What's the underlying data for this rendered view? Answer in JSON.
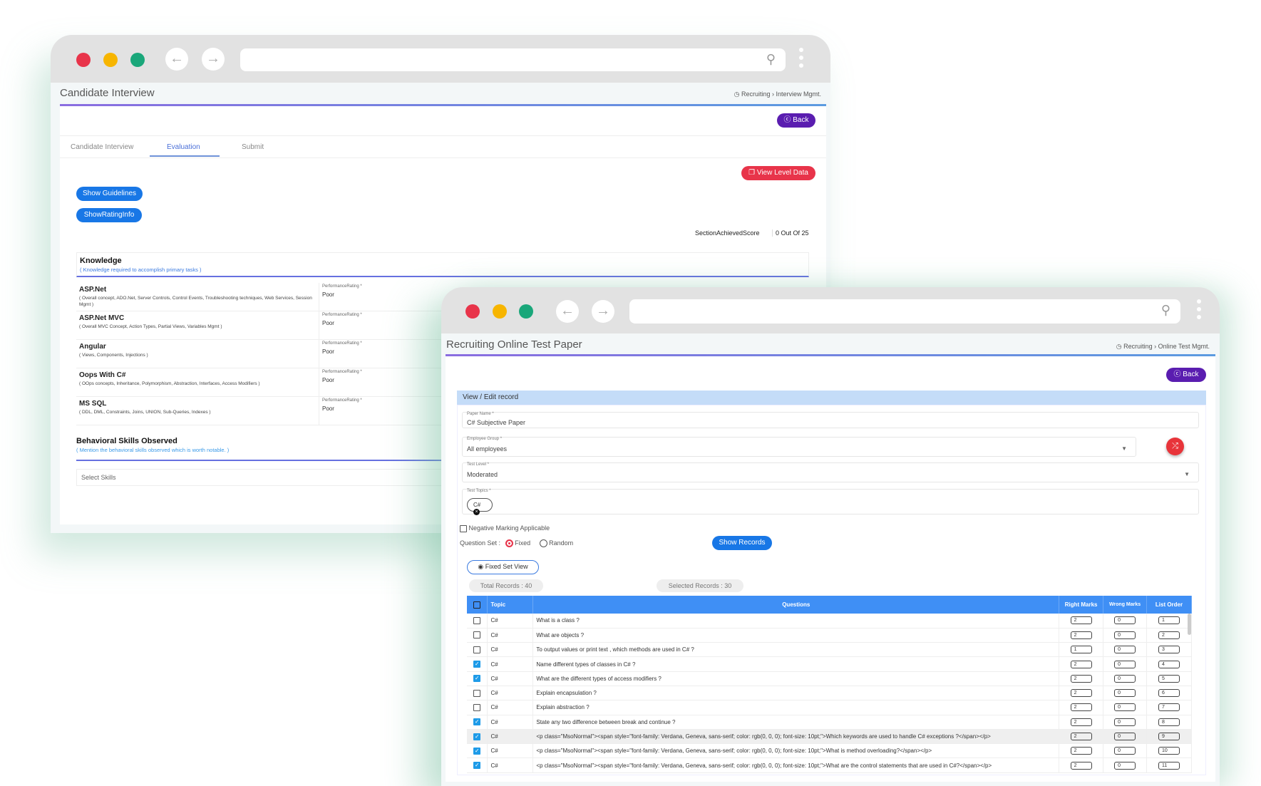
{
  "colors": {
    "red": "#e8344a",
    "yellow": "#f7b500",
    "green": "#1aa77a",
    "back": "#5a1db0",
    "blue": "#1877e6",
    "header": "#3f8ff5"
  },
  "interview": {
    "title": "Candidate Interview",
    "breadcrumb": [
      "Recruiting",
      "Interview Mgmt."
    ],
    "back_label": "Back",
    "tabs": [
      {
        "label": "Candidate Interview"
      },
      {
        "label": "Evaluation"
      },
      {
        "label": "Submit"
      }
    ],
    "view_level_data": "View Level Data",
    "show_guidelines": "Show Guidelines",
    "show_rating_info": "ShowRatingInfo",
    "score_label": "SectionAchievedScore",
    "score_value": "0 Out Of 25",
    "knowledge": {
      "title": "Knowledge",
      "subtitle": "( Knowledge required to accomplish primary tasks )"
    },
    "rating_label": "PerformanceRating *",
    "skills": [
      {
        "name": "ASP.Net",
        "desc": "( Overall concept, ADO.Net, Server Controls, Control Events, Troubleshooting techniques, Web Services, Session Mgmt )",
        "rating": "Poor"
      },
      {
        "name": "ASP.Net MVC",
        "desc": "( Overall MVC Concept, Action Types, Partial Views, Variables Mgmt )",
        "rating": "Poor"
      },
      {
        "name": "Angular",
        "desc": "( Views, Components, Injections )",
        "rating": "Poor"
      },
      {
        "name": "Oops With C#",
        "desc": "( OOps concepts, Inheritance, Polymorphism, Abstraction, Interfaces, Access Modifiers )",
        "rating": "Poor"
      },
      {
        "name": "MS SQL",
        "desc": "( DDL, DML, Constraints, Joins, UNION, Sub-Queries, Indexes )",
        "rating": "Poor"
      }
    ],
    "behavioral": {
      "title": "Behavioral Skills Observed",
      "subtitle": "( Mention the behavioral skills observed which is worth notable. )",
      "placeholder": "Select Skills"
    }
  },
  "testpaper": {
    "title": "Recruiting Online Test Paper",
    "breadcrumb": [
      "Recruiting",
      "Online Test Mgmt."
    ],
    "back_label": "Back",
    "section_title": "View / Edit record",
    "paper_name": {
      "label": "Paper Name *",
      "value": "C# Subjective Paper"
    },
    "employee_group": {
      "label": "Employee Group *",
      "value": "All employees"
    },
    "test_level": {
      "label": "Test Level *",
      "value": "Moderated"
    },
    "test_topics": {
      "label": "Test Topics *",
      "chips": [
        "C#"
      ]
    },
    "negative_marking": "Negative Marking Applicable",
    "question_set": {
      "label": "Question Set :",
      "options": [
        "Fixed",
        "Random"
      ],
      "selected": "Fixed"
    },
    "show_records": "Show Records",
    "fixed_set_view": "Fixed Set View",
    "total_records": "Total Records : 40",
    "selected_records": "Selected Records : 30",
    "columns": [
      "Topic",
      "Questions",
      "Right Marks",
      "Wrong Marks",
      "List Order"
    ],
    "rows": [
      {
        "checked": false,
        "topic": "C#",
        "question": "What is a class ?",
        "right": "2",
        "wrong": "0",
        "order": "1"
      },
      {
        "checked": false,
        "topic": "C#",
        "question": "What are objects ?",
        "right": "2",
        "wrong": "0",
        "order": "2"
      },
      {
        "checked": false,
        "topic": "C#",
        "question": "To output values or print text , which methods are used in C# ?",
        "right": "1",
        "wrong": "0",
        "order": "3"
      },
      {
        "checked": true,
        "topic": "C#",
        "question": "Name different types of classes in C# ?",
        "right": "2",
        "wrong": "0",
        "order": "4"
      },
      {
        "checked": true,
        "topic": "C#",
        "question": "What are the different types of access modifiers ?",
        "right": "2",
        "wrong": "0",
        "order": "5"
      },
      {
        "checked": false,
        "topic": "C#",
        "question": "Explain encapsulation ?",
        "right": "2",
        "wrong": "0",
        "order": "6"
      },
      {
        "checked": false,
        "topic": "C#",
        "question": "Explain abstraction ?",
        "right": "2",
        "wrong": "0",
        "order": "7"
      },
      {
        "checked": true,
        "topic": "C#",
        "question": "State any two difference between break and continue ?",
        "right": "2",
        "wrong": "0",
        "order": "8"
      },
      {
        "checked": true,
        "topic": "C#",
        "question": "<p class=\"MsoNormal\"><span style=\"font-family: Verdana, Geneva, sans-serif; color: rgb(0, 0, 0); font-size: 10pt;\">Which keywords are used to handle C# exceptions ?</span></p>",
        "right": "2",
        "wrong": "0",
        "order": "9"
      },
      {
        "checked": true,
        "topic": "C#",
        "question": "<p class=\"MsoNormal\"><span style=\"font-family: Verdana, Geneva, sans-serif; color: rgb(0, 0, 0); font-size: 10pt;\">What is method overloading?</span></p>",
        "right": "2",
        "wrong": "0",
        "order": "10"
      },
      {
        "checked": true,
        "topic": "C#",
        "question": "<p class=\"MsoNormal\"><span style=\"font-family: Verdana, Geneva, sans-serif; color: rgb(0, 0, 0); font-size: 10pt;\">What are the control statements that are used in C#?</span></p>",
        "right": "2",
        "wrong": "0",
        "order": "11"
      }
    ]
  }
}
